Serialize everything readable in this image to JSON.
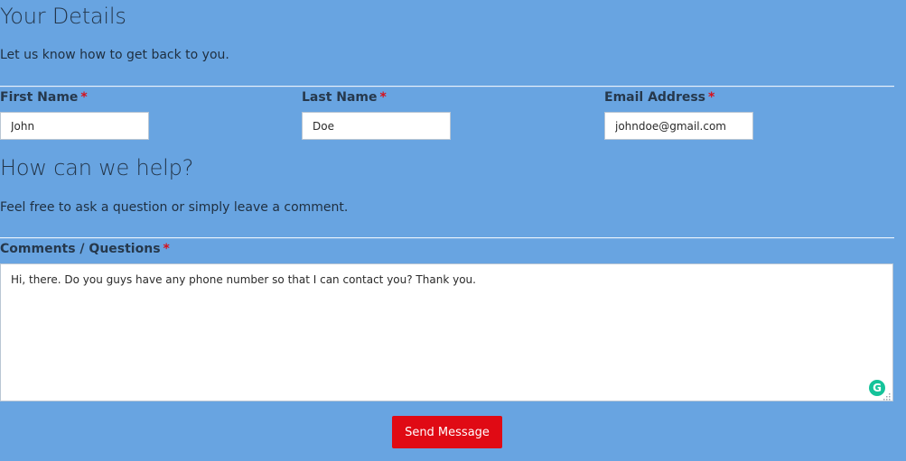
{
  "details": {
    "title": "Your Details",
    "description": "Let us know how to get back to you."
  },
  "fields": {
    "first_name": {
      "label": "First Name",
      "required_mark": "*",
      "value": "John"
    },
    "last_name": {
      "label": "Last Name",
      "required_mark": "*",
      "value": "Doe"
    },
    "email": {
      "label": "Email Address",
      "required_mark": "*",
      "value": "johndoe@gmail.com"
    }
  },
  "help": {
    "title": "How can we help?",
    "description": "Feel free to ask a question or simply leave a comment."
  },
  "comments": {
    "label": "Comments / Questions",
    "required_mark": "*",
    "value": "Hi, there. Do you guys have any phone number so that I can contact you? Thank you."
  },
  "grammarly": {
    "icon": "grammarly-icon",
    "glyph": "G",
    "color": "#15c39a"
  },
  "submit": {
    "label": "Send Message",
    "color": "#e00a14"
  },
  "colors": {
    "background": "#68a4e1",
    "required": "#d8101a"
  }
}
